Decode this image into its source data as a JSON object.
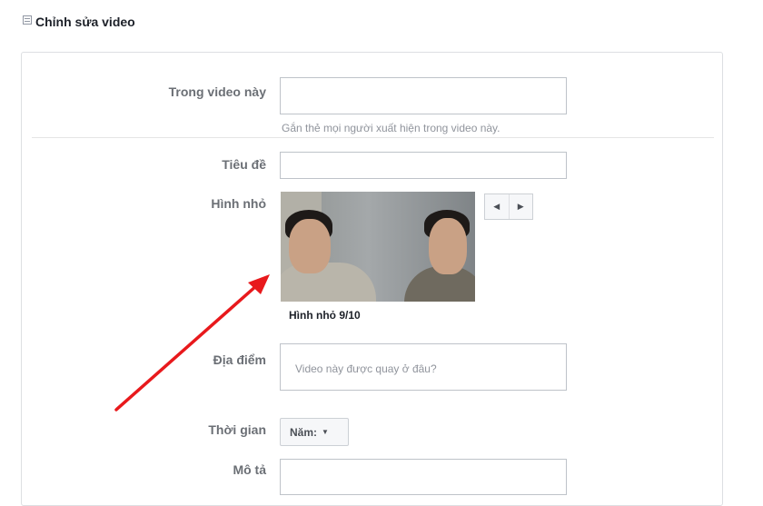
{
  "header": {
    "title": "Chỉnh sửa video",
    "icon": "collapse-icon"
  },
  "form": {
    "tag_people": {
      "label": "Trong video này",
      "hint": "Gắn thẻ mọi người xuất hiện trong video này."
    },
    "title": {
      "label": "Tiêu đề",
      "value": ""
    },
    "thumbnail": {
      "label": "Hình nhỏ",
      "caption": "Hình nhỏ 9/10",
      "prev_icon": "◀",
      "next_icon": "▶"
    },
    "location": {
      "label": "Địa điểm",
      "placeholder": "Video này được quay ở đâu?"
    },
    "time": {
      "label": "Thời gian",
      "year_select": "Năm:",
      "caret": "▼"
    },
    "description": {
      "label": "Mô tả",
      "value": ""
    }
  },
  "colors": {
    "accent": "#e8191c",
    "border": "#bec3c9",
    "label": "#6b6f75"
  }
}
